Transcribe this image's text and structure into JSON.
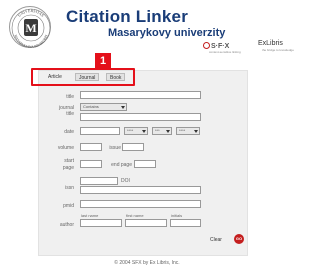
{
  "header": {
    "title": "Citation Linker",
    "subtitle": "Masarykovy univerzity",
    "sfx_logo": "S·F·X",
    "sfx_tagline": "context-sensitive linking",
    "exlibris_logo": "ExLibris",
    "exlibris_tagline": "the bridge to knowledge",
    "seal_icon": "university-seal",
    "seal_text_top": "UNIVERSITAS",
    "seal_text_bottom": "MASARYKIANA BRUNENSIS",
    "seal_letter": "M"
  },
  "callout": {
    "number": "1",
    "color": "#e4101a"
  },
  "tabs": [
    {
      "label": "Article",
      "active": true
    },
    {
      "label": "Journal",
      "active": false
    },
    {
      "label": "Book",
      "active": false
    }
  ],
  "form": {
    "title_label": "title",
    "journal_title_label_1": "journal",
    "journal_title_label_2": "title",
    "match_select": "Contains",
    "date_label": "date",
    "date_year_placeholder": "****",
    "date_month_placeholder": "***",
    "date_day_placeholder": "****",
    "volume_label": "volume",
    "issue_label": "issue",
    "start_page_label_1": "start",
    "start_page_label_2": "page",
    "end_page_label": "end page",
    "issn_label": "issn",
    "doi_label": "DOI",
    "pmid_label": "pmid",
    "author_label": "author",
    "last_name_label": "last name",
    "first_name_label": "first name",
    "initials_label": "initials"
  },
  "actions": {
    "clear_label": "Clear",
    "go_label": "GO"
  },
  "footer": {
    "text": "© 2004 SFX by Ex Libris, Inc."
  },
  "colors": {
    "brand_blue": "#1a3d78",
    "go_red": "#c41e1e"
  }
}
